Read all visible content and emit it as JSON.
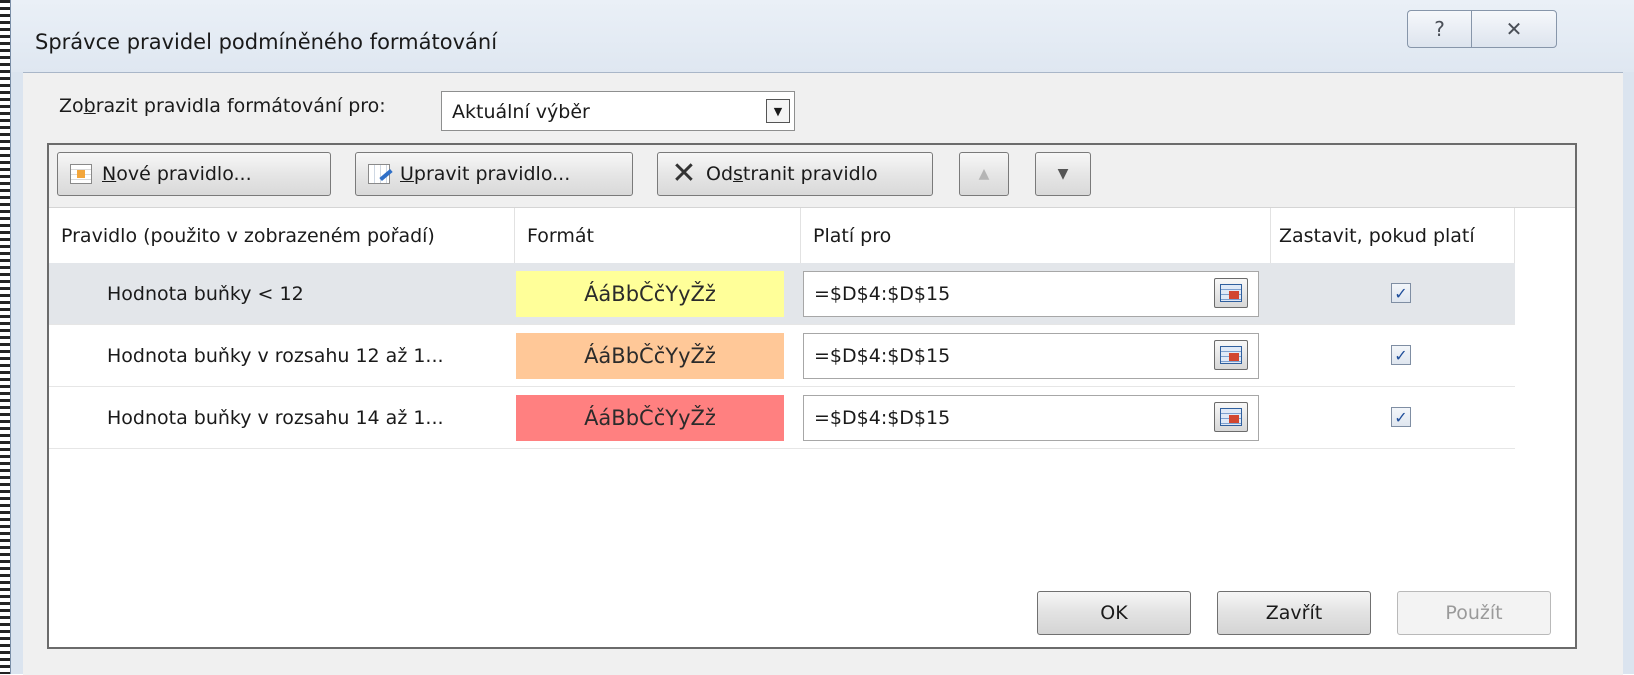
{
  "dialog": {
    "title": "Správce pravidel podmíněného formátování",
    "help_label": "?",
    "close_label": "✕"
  },
  "scope": {
    "label_prefix": "Zo",
    "label_accel": "b",
    "label_suffix": "razit pravidla formátování pro:",
    "selected": "Aktuální výběr"
  },
  "toolbar": {
    "new_accel": "N",
    "new_rest": "ové pravidlo...",
    "edit_accel": "U",
    "edit_rest": "pravit pravidlo...",
    "delete_prefix": "Od",
    "delete_accel": "s",
    "delete_rest": "tranit pravidlo",
    "move_up": "▲",
    "move_down": "▼"
  },
  "table": {
    "headers": {
      "rule": "Pravidlo (použito v zobrazeném pořadí)",
      "format": "Formát",
      "applies_to": "Platí pro",
      "stop_if_true": "Zastavit, pokud platí"
    },
    "rows": [
      {
        "rule": "Hodnota buňky < 12",
        "format_preview": "ÁáBbČčYyŽž",
        "format_color": "#ffff99",
        "applies_to": "=$D$4:$D$15",
        "stop_if_true": true
      },
      {
        "rule": "Hodnota buňky v rozsahu 12 až 1...",
        "format_preview": "ÁáBbČčYyŽž",
        "format_color": "#ffc898",
        "applies_to": "=$D$4:$D$15",
        "stop_if_true": true
      },
      {
        "rule": "Hodnota buňky v rozsahu 14 až 1...",
        "format_preview": "ÁáBbČčYyŽž",
        "format_color": "#ff8080",
        "applies_to": "=$D$4:$D$15",
        "stop_if_true": true
      }
    ]
  },
  "footer": {
    "ok": "OK",
    "close": "Zavřít",
    "apply": "Použít"
  }
}
